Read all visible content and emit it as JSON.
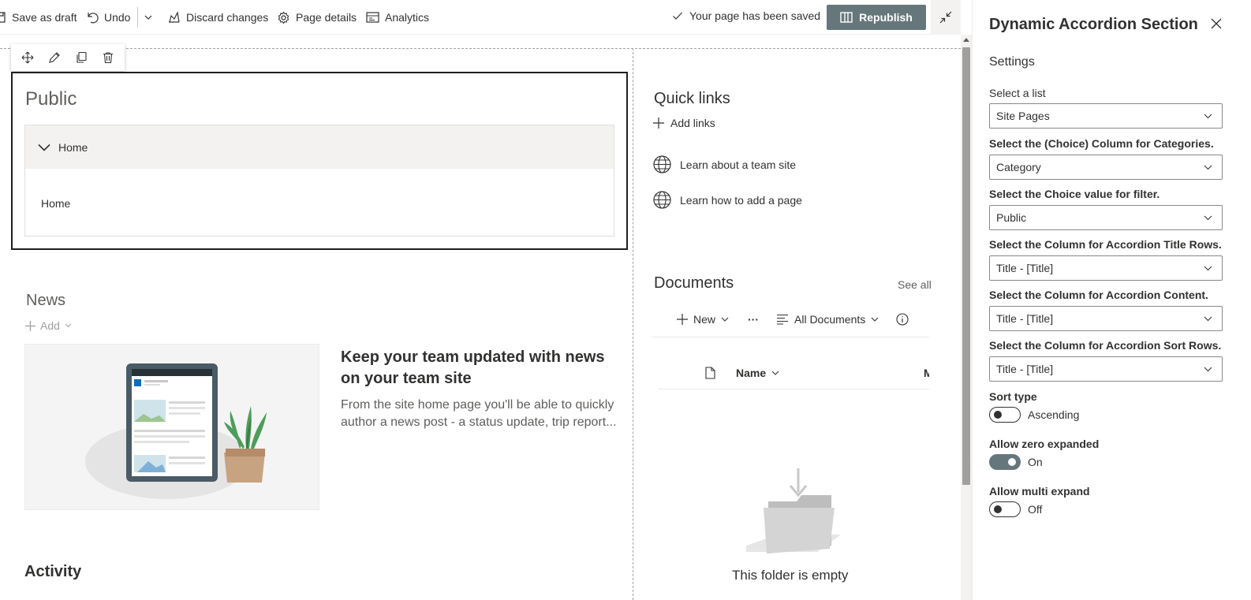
{
  "toolbar": {
    "save_draft": "Save as draft",
    "undo": "Undo",
    "discard": "Discard changes",
    "page_details": "Page details",
    "analytics": "Analytics",
    "status": "Your page has been saved",
    "republish": "Republish"
  },
  "accordion": {
    "title": "Public",
    "items": [
      {
        "header": "Home",
        "content": "Home"
      }
    ]
  },
  "news": {
    "title": "News",
    "add": "Add",
    "headline": "Keep your team updated with news on your team site",
    "description": "From the site home page you'll be able to quickly author a news post - a status update, trip report..."
  },
  "activity": {
    "title": "Activity"
  },
  "quick_links": {
    "title": "Quick links",
    "add": "Add links",
    "links": [
      {
        "label": "Learn about a team site",
        "icon": "globe-icon"
      },
      {
        "label": "Learn how to add a page",
        "icon": "globe-icon"
      }
    ]
  },
  "documents": {
    "title": "Documents",
    "see_all": "See all",
    "new": "New",
    "more": "···",
    "view": "All Documents",
    "name_column": "Name",
    "next_column_partial": "M",
    "empty": "This folder is empty"
  },
  "property_pane": {
    "title": "Dynamic Accordion Section",
    "settings": "Settings",
    "fields": [
      {
        "label": "Select a list",
        "value": "Site Pages"
      },
      {
        "label": "Select the (Choice) Column for Categories.",
        "value": "Category"
      },
      {
        "label": "Select the Choice value for filter.",
        "value": "Public"
      },
      {
        "label": "Select the Column for Accordion Title Rows.",
        "value": "Title - [Title]"
      },
      {
        "label": "Select the Column for Accordion Content.",
        "value": "Title - [Title]"
      },
      {
        "label": "Select the Column for Accordion Sort Rows.",
        "value": "Title - [Title]"
      }
    ],
    "toggles": [
      {
        "label": "Sort type",
        "state": "Ascending",
        "on": false
      },
      {
        "label": "Allow zero expanded",
        "state": "On",
        "on": true
      },
      {
        "label": "Allow multi expand",
        "state": "Off",
        "on": false
      }
    ]
  },
  "colors": {
    "accent": "#66777c",
    "text": "#323130",
    "muted": "#605e5c"
  }
}
